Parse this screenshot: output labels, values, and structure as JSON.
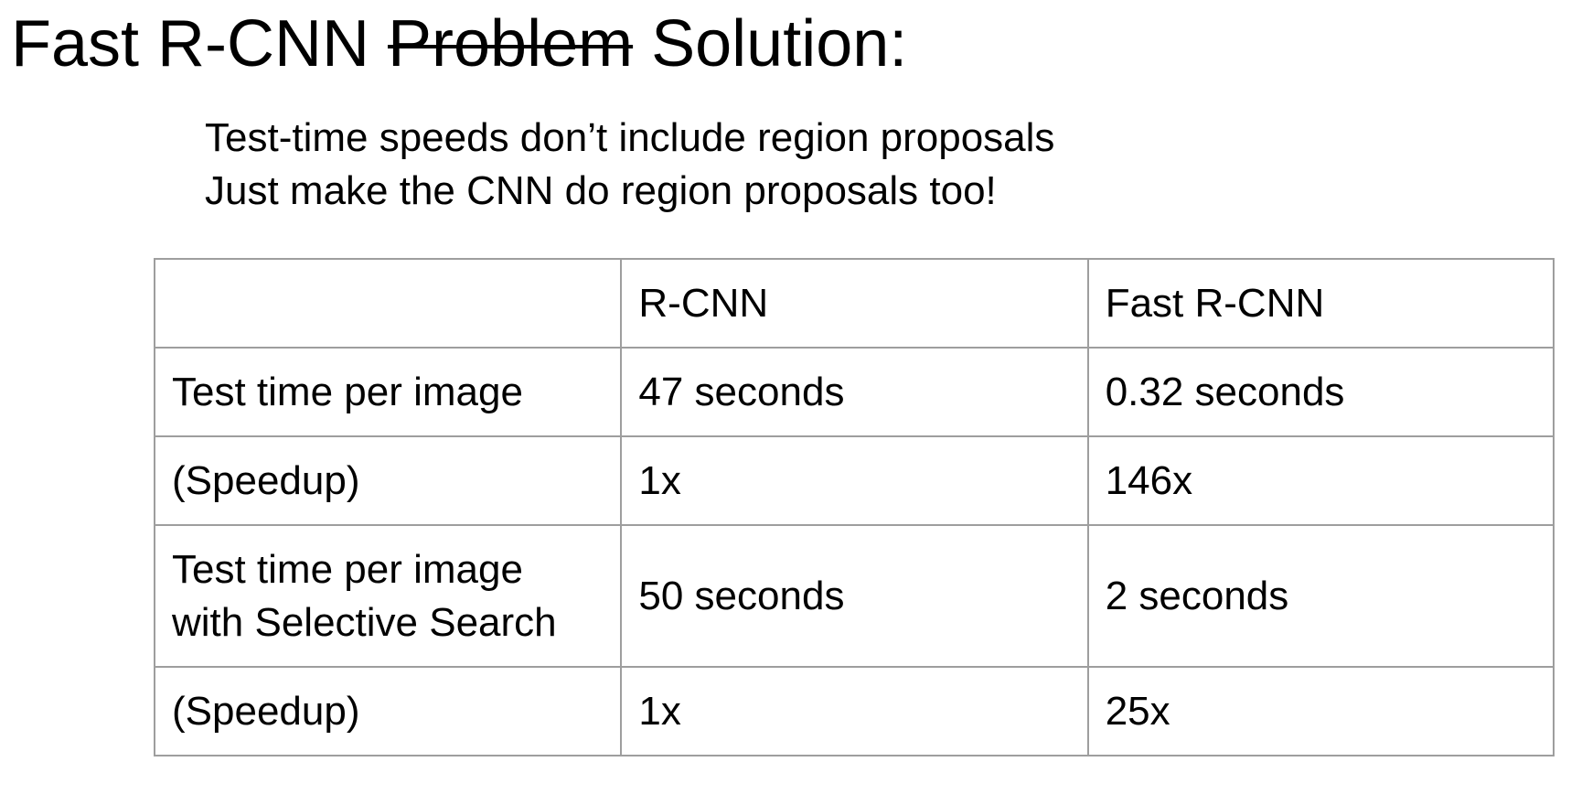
{
  "slide": {
    "title_prefix": "Fast R-CNN ",
    "title_struck": "Problem",
    "title_suffix": " Solution:",
    "bullets": [
      "Test-time speeds don’t include region proposals",
      "Just make the CNN do region proposals too!"
    ]
  },
  "table": {
    "header": [
      "",
      "R-CNN",
      "Fast R-CNN"
    ],
    "rows": [
      {
        "label": "Test time per image",
        "rcnn": "47 seconds",
        "fast": "0.32 seconds"
      },
      {
        "label": "(Speedup)",
        "rcnn": "1x",
        "fast": "146x"
      },
      {
        "label_line1": "Test time per image",
        "label_line2": "with Selective Search",
        "rcnn": "50 seconds",
        "fast": "2 seconds"
      },
      {
        "label": "(Speedup)",
        "rcnn": "1x",
        "fast": "25x"
      }
    ]
  }
}
